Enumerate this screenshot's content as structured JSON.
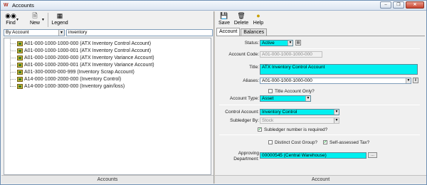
{
  "window": {
    "title": "Accounts"
  },
  "left_toolbar": {
    "find_label": "Find",
    "new_label": "New",
    "legend_label": "Legend"
  },
  "filter": {
    "field_value": "By Account",
    "search_value": "inventory"
  },
  "tree_items": [
    "A01-000-1000-1000-000 (ATX  Inventory Control Account)",
    "A01-000-1000-1000-001 (ATX  Inventory Control Account)",
    "A01-000-1000-2000-000 (ATX  Inventory Variance Account)",
    "A01-000-1000-2000-001 (ATX  Inventory Variance Account)",
    "A01-300-0000-000-999 (Inventory Scrap Account)",
    "A14-000-1000-2000-000 (Inventory Control)",
    "A14-000-1000-3000-000 (Inventory gain/loss)"
  ],
  "left_footer": "Accounts",
  "right_toolbar": {
    "save_label": "Save",
    "delete_label": "Delete",
    "help_label": "Help"
  },
  "tabs": [
    "Account",
    "Balances"
  ],
  "form": {
    "status_label": "Status:",
    "status_value": "Active",
    "account_code_label": "Account Code:",
    "account_code_value": "A01-000-1000-1000-000",
    "title_label": "Title:",
    "title_value": "ATX Inventory Control Account",
    "aliases_label": "Aliases:",
    "aliases_value": "A01-000-1000-1000-000",
    "title_only_label": "Title Account Only?",
    "account_type_label": "Account Type:",
    "account_type_value": "Asset",
    "control_account_label": "Control Account:",
    "control_account_value": "Inventory Control",
    "subledger_by_label": "Subledger By:",
    "subledger_by_value": "Stock",
    "subledger_required_label": "Subledger number is required?",
    "distinct_cost_group_label": "Distinct Cost Group?",
    "self_assessed_label": "Self-assessed Tax?",
    "approving_dept_label_1": "Approving",
    "approving_dept_label_2": "Department:",
    "approving_dept_value": "00000545 (Central Warehouse)"
  },
  "right_footer": "Account",
  "colors": {
    "required_field": "#00f0f0",
    "window_border": "#6f8fb3"
  }
}
